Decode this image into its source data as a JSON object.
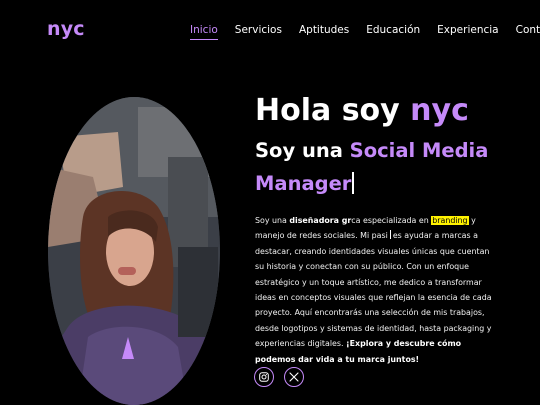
{
  "brand": {
    "logo": "nyc",
    "accent_color": "#c58af9"
  },
  "nav": {
    "items": [
      {
        "label": "Inicio",
        "active": true
      },
      {
        "label": "Servicios",
        "active": false
      },
      {
        "label": "Aptitudes",
        "active": false
      },
      {
        "label": "Educación",
        "active": false
      },
      {
        "label": "Experiencia",
        "active": false
      },
      {
        "label": "Contácto",
        "active": false
      }
    ]
  },
  "hero": {
    "greeting_prefix": "Hola soy ",
    "greeting_name": "nyc",
    "role_prefix": "Soy una ",
    "role_highlight_1": "Social Media",
    "role_highlight_2": "Manager",
    "bio": {
      "p1": "Soy una ",
      "bold1": "diseñadora gr",
      "p2": "ca especializada en ",
      "highlight": "branding",
      "p3": " y manejo de redes sociales. Mi pasi",
      "p4": "es ayudar a marcas a destacar, creando identidades visuales únicas que cuentan su historia y conectan con su público. Con un enfoque estratégico y un toque artístico, me dedico a transformar ideas en conceptos visuales que reflejan la esencia de cada proyecto. Aquí encontrarás una selección de mis trabajos, desde logotipos y sistemas de identidad, hasta packaging y experiencias digitales. ",
      "cta": "¡Explora y descubre cómo podemos dar vida a tu marca juntos!"
    }
  },
  "social": [
    {
      "icon": "instagram-icon"
    },
    {
      "icon": "x-icon"
    }
  ]
}
